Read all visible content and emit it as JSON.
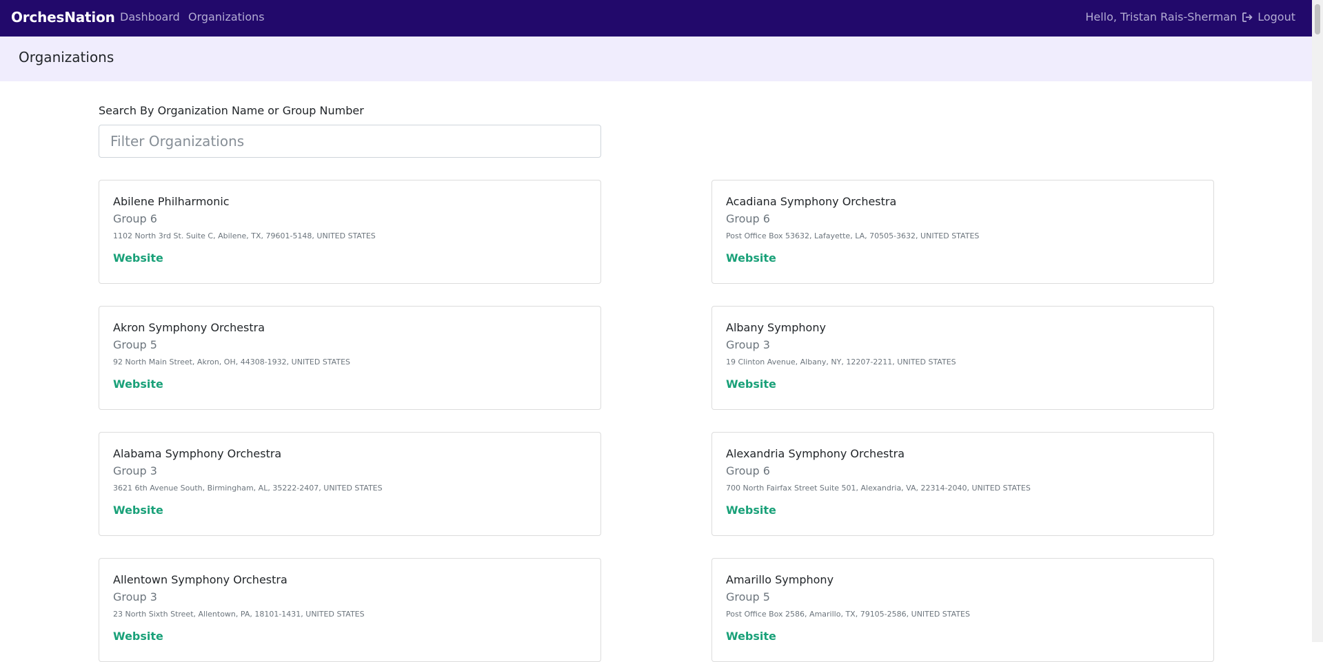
{
  "navbar": {
    "brand": "OrchesNation",
    "links": [
      "Dashboard",
      "Organizations"
    ],
    "greeting": "Hello, Tristan Rais-Sherman",
    "logout_label": "Logout",
    "logout_icon": "sign-out-icon"
  },
  "subheader": {
    "title": "Organizations"
  },
  "search": {
    "label": "Search By Organization Name or Group Number",
    "placeholder": "Filter Organizations",
    "value": ""
  },
  "organizations": [
    {
      "name": "Abilene Philharmonic",
      "group": "Group 6",
      "address": "1102 North 3rd St. Suite C, Abilene, TX, 79601-5148, UNITED STATES",
      "link_label": "Website"
    },
    {
      "name": "Acadiana Symphony Orchestra",
      "group": "Group 6",
      "address": "Post Office Box 53632, Lafayette, LA, 70505-3632, UNITED STATES",
      "link_label": "Website"
    },
    {
      "name": "Akron Symphony Orchestra",
      "group": "Group 5",
      "address": "92 North Main Street, Akron, OH, 44308-1932, UNITED STATES",
      "link_label": "Website"
    },
    {
      "name": "Albany Symphony",
      "group": "Group 3",
      "address": "19 Clinton Avenue, Albany, NY, 12207-2211, UNITED STATES",
      "link_label": "Website"
    },
    {
      "name": "Alabama Symphony Orchestra",
      "group": "Group 3",
      "address": "3621 6th Avenue South, Birmingham, AL, 35222-2407, UNITED STATES",
      "link_label": "Website"
    },
    {
      "name": "Alexandria Symphony Orchestra",
      "group": "Group 6",
      "address": "700 North Fairfax Street Suite 501, Alexandria, VA, 22314-2040, UNITED STATES",
      "link_label": "Website"
    },
    {
      "name": "Allentown Symphony Orchestra",
      "group": "Group 3",
      "address": "23 North Sixth Street, Allentown, PA, 18101-1431, UNITED STATES",
      "link_label": "Website"
    },
    {
      "name": "Amarillo Symphony",
      "group": "Group 5",
      "address": "Post Office Box 2586, Amarillo, TX, 79105-2586, UNITED STATES",
      "link_label": "Website"
    }
  ],
  "colors": {
    "navbar_bg": "#22096b",
    "subheader_bg": "#f0edfd",
    "link_green": "#1aa179"
  }
}
